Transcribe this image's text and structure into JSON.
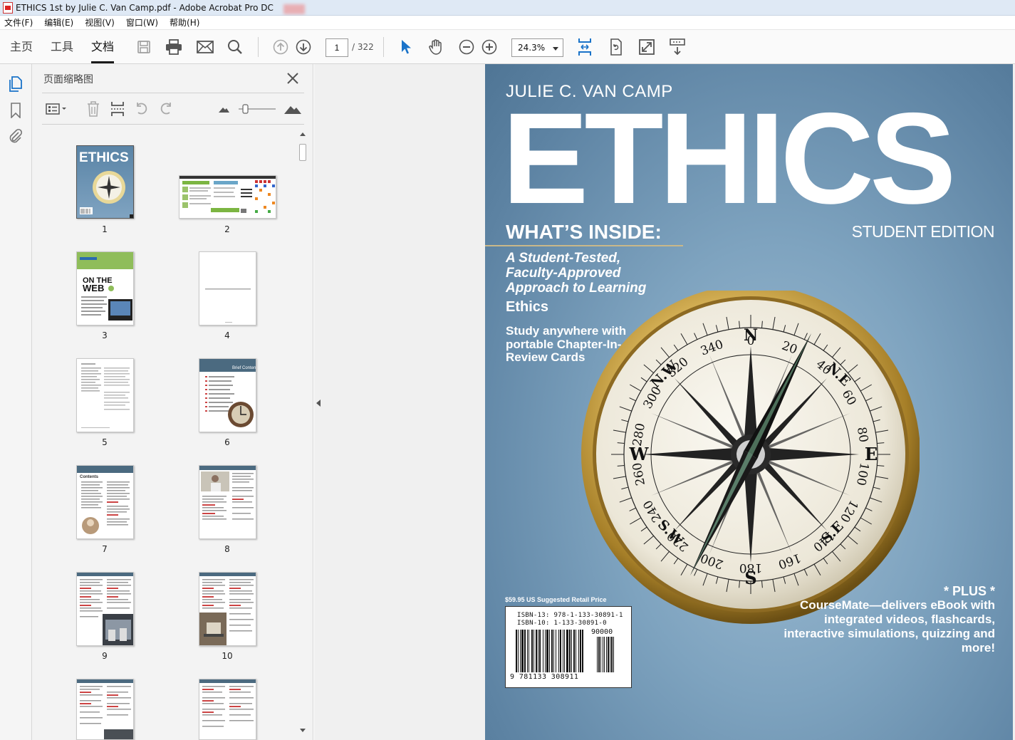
{
  "window": {
    "title": "ETHICS 1st by Julie C. Van Camp.pdf - Adobe Acrobat Pro DC"
  },
  "menu": [
    "文件(F)",
    "编辑(E)",
    "视图(V)",
    "窗口(W)",
    "帮助(H)"
  ],
  "toolbar": {
    "tabs": [
      "主页",
      "工具",
      "文档"
    ],
    "active_tab": "文档",
    "page_current": "1",
    "page_total": "/ 322",
    "zoom": "24.3%"
  },
  "panel": {
    "title": "页面缩略图",
    "thumbnail_labels": [
      "1",
      "2",
      "3",
      "4",
      "5",
      "6",
      "7",
      "8",
      "9",
      "10"
    ]
  },
  "cover": {
    "author": "JULIE C. VAN CAMP",
    "title": "ETHICS",
    "whats_inside": "WHAT’S INSIDE:",
    "edition": "STUDENT EDITION",
    "tagline": "A Student-Tested, Faculty-Approved Approach to Learning",
    "subject": "Ethics",
    "study": "Study anywhere with portable Chapter-In-Review Cards",
    "price": "$59.95 US Suggested Retail Price",
    "isbn13": "ISBN-13: 978-1-133-30891-1",
    "isbn10": "ISBN-10: 1-133-30891-0",
    "barcode_price": "90000",
    "barcode_digits": "9 781133 308911",
    "plus_head": "* PLUS *",
    "plus_body": "CourseMate—delivers eBook with integrated videos, flashcards, interactive simulations, quizzing and more!",
    "compass_labels": {
      "north": "N",
      "south": "S",
      "east": "E",
      "west": "W",
      "ne": "N.E",
      "nw": "N.W",
      "se": "S.E",
      "sw": "S.W",
      "degrees": [
        "0",
        "20",
        "40",
        "60",
        "80",
        "100",
        "120",
        "140",
        "160",
        "180",
        "200",
        "220",
        "240",
        "260",
        "280",
        "300",
        "320",
        "340"
      ]
    }
  },
  "colors": {
    "toolbar_bg": "#fafafa",
    "panel_bg": "#f3f3f3",
    "cover_blue": "#6a8fae",
    "acrobat_blue": "#1a73c9"
  }
}
